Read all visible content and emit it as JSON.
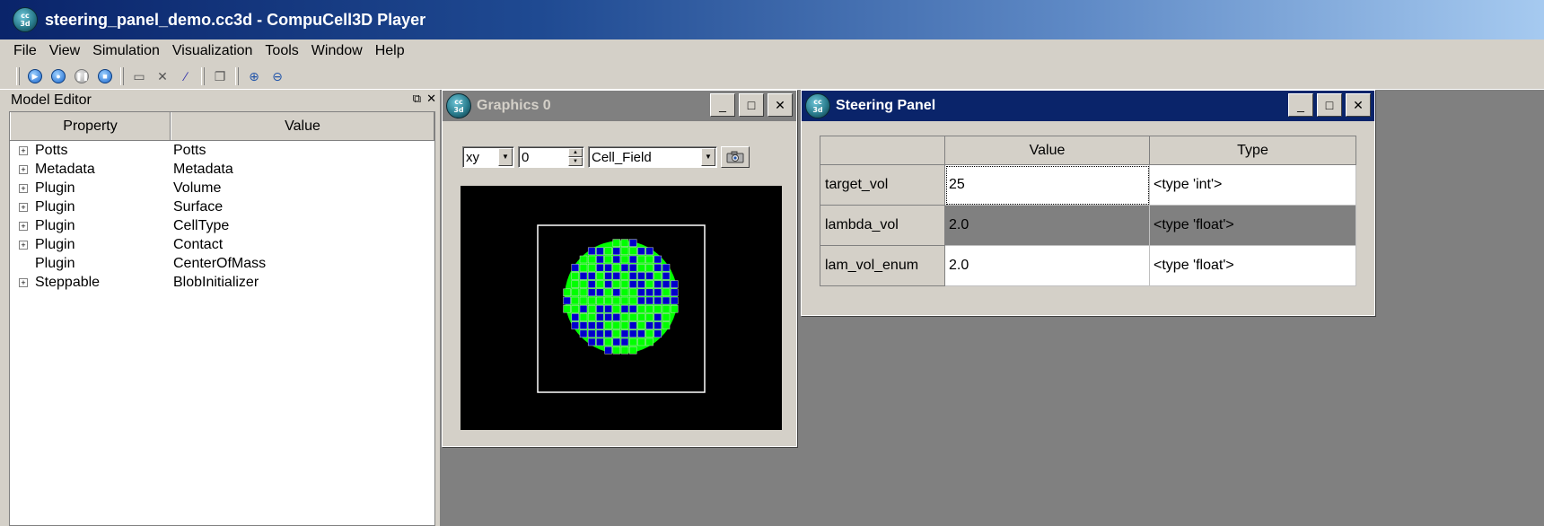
{
  "window": {
    "title": "steering_panel_demo.cc3d - CompuCell3D Player",
    "icon_text": "cc\n3d"
  },
  "menubar": {
    "items": [
      "File",
      "View",
      "Simulation",
      "Visualization",
      "Tools",
      "Window",
      "Help"
    ]
  },
  "toolbar": {
    "buttons": [
      "run-icon",
      "step-icon",
      "pause-icon",
      "stop-icon",
      "open-icon",
      "tools-icon",
      "edit-icon",
      "new-window-icon",
      "zoom-in-icon",
      "zoom-out-icon"
    ]
  },
  "model_editor": {
    "title": "Model Editor",
    "columns": [
      "Property",
      "Value"
    ],
    "rows": [
      {
        "property": "Potts",
        "value": "Potts",
        "expandable": true
      },
      {
        "property": "Metadata",
        "value": "Metadata",
        "expandable": true
      },
      {
        "property": "Plugin",
        "value": "Volume",
        "expandable": true
      },
      {
        "property": "Plugin",
        "value": "Surface",
        "expandable": true
      },
      {
        "property": "Plugin",
        "value": "CellType",
        "expandable": true
      },
      {
        "property": "Plugin",
        "value": "Contact",
        "expandable": true
      },
      {
        "property": "Plugin",
        "value": "CenterOfMass",
        "expandable": false
      },
      {
        "property": "Steppable",
        "value": "BlobInitializer",
        "expandable": true
      }
    ]
  },
  "graphics_window": {
    "title": "Graphics 0",
    "plane": "xy",
    "position": "0",
    "field": "Cell_Field",
    "colors": {
      "background": "#000000",
      "cell_green": "#00ff00",
      "cell_blue": "#0000cc",
      "border": "#ffffff"
    }
  },
  "steering_panel": {
    "title": "Steering Panel",
    "columns": [
      "Value",
      "Type"
    ],
    "rows": [
      {
        "name": "target_vol",
        "value": "25",
        "type": "<type 'int'>"
      },
      {
        "name": "lambda_vol",
        "value": "2.0",
        "type": "<type 'float'>"
      },
      {
        "name": "lam_vol_enum",
        "value": "2.0",
        "type": "<type 'float'>"
      }
    ]
  },
  "win_buttons": {
    "minimize": "_",
    "maximize": "□",
    "close": "✕"
  }
}
